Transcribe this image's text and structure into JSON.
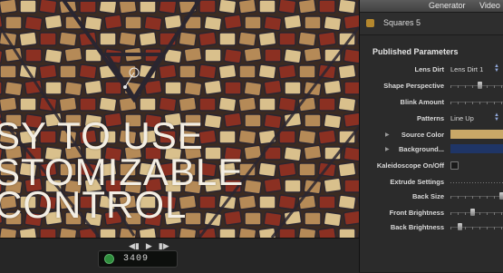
{
  "panel": {
    "tabs": {
      "generator": "Generator",
      "video": "Video"
    },
    "generator_name": "Squares 5",
    "section_title": "Published Parameters",
    "params": [
      {
        "label": "Lens Dirt",
        "value": "Lens Dirt 1"
      },
      {
        "label": "Shape Perspective"
      },
      {
        "label": "Blink Amount"
      },
      {
        "label": "Patterns",
        "value": "Line Up"
      },
      {
        "label": "Source Color",
        "color": "#c9a867"
      },
      {
        "label": "Background...",
        "color": "#1f3566"
      },
      {
        "label": "Kaleidoscope On/Off"
      },
      {
        "label": "Extrude Settings"
      },
      {
        "label": "Back Size"
      },
      {
        "label": "Front Brightness"
      },
      {
        "label": "Back Brightness"
      }
    ]
  },
  "viewer": {
    "overlay_lines": [
      "SY TO USE",
      "STOMIZABLE",
      "CONTROL"
    ],
    "timecode": "3409"
  },
  "colors": {
    "tile_red": "#8b3022",
    "tile_cream": "#d9c08c",
    "tile_tan": "#b58a57",
    "grout": "#2a2630"
  }
}
